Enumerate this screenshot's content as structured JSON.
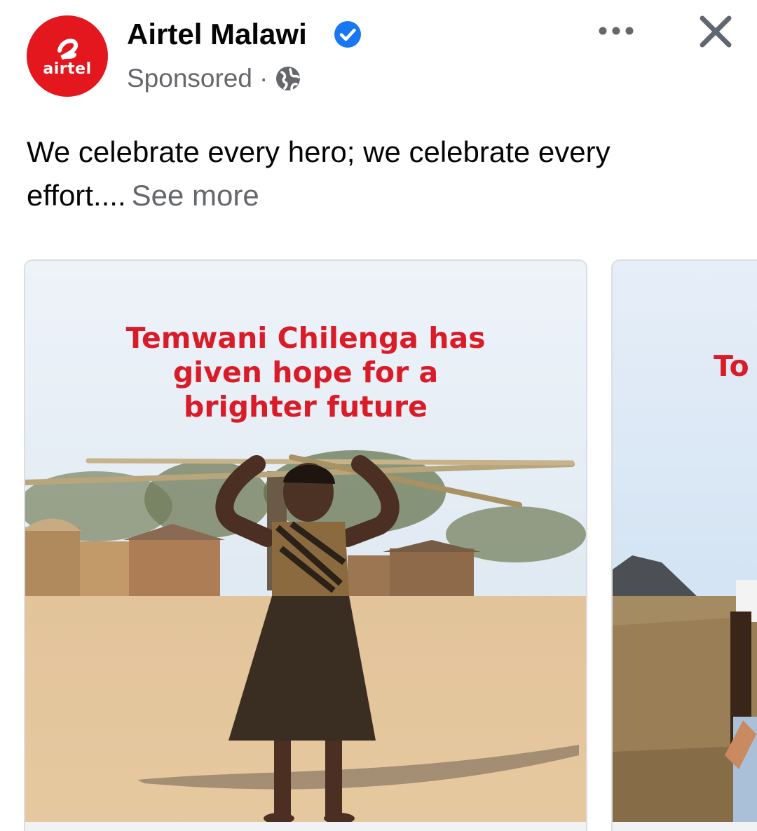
{
  "header": {
    "page_name": "Airtel Malawi",
    "sponsored_label": "Sponsored",
    "separator": "·",
    "logo_text": "airtel",
    "verified_icon": "verified-badge-icon",
    "privacy_icon": "globe-icon",
    "more_icon": "more-options-icon",
    "close_icon": "close-icon"
  },
  "post": {
    "text": "We celebrate every hero; we celebrate every effort....",
    "see_more_label": "See more"
  },
  "carousel": {
    "cards": [
      {
        "headline_lines": [
          "Temwani Chilenga has",
          "given hope for a",
          "brighter future"
        ]
      },
      {
        "headline_partial": "To"
      }
    ]
  },
  "colors": {
    "brand_red": "#e4161e",
    "headline_red": "#d91c28",
    "verified_blue": "#1877f2",
    "secondary_text": "#65676b"
  }
}
